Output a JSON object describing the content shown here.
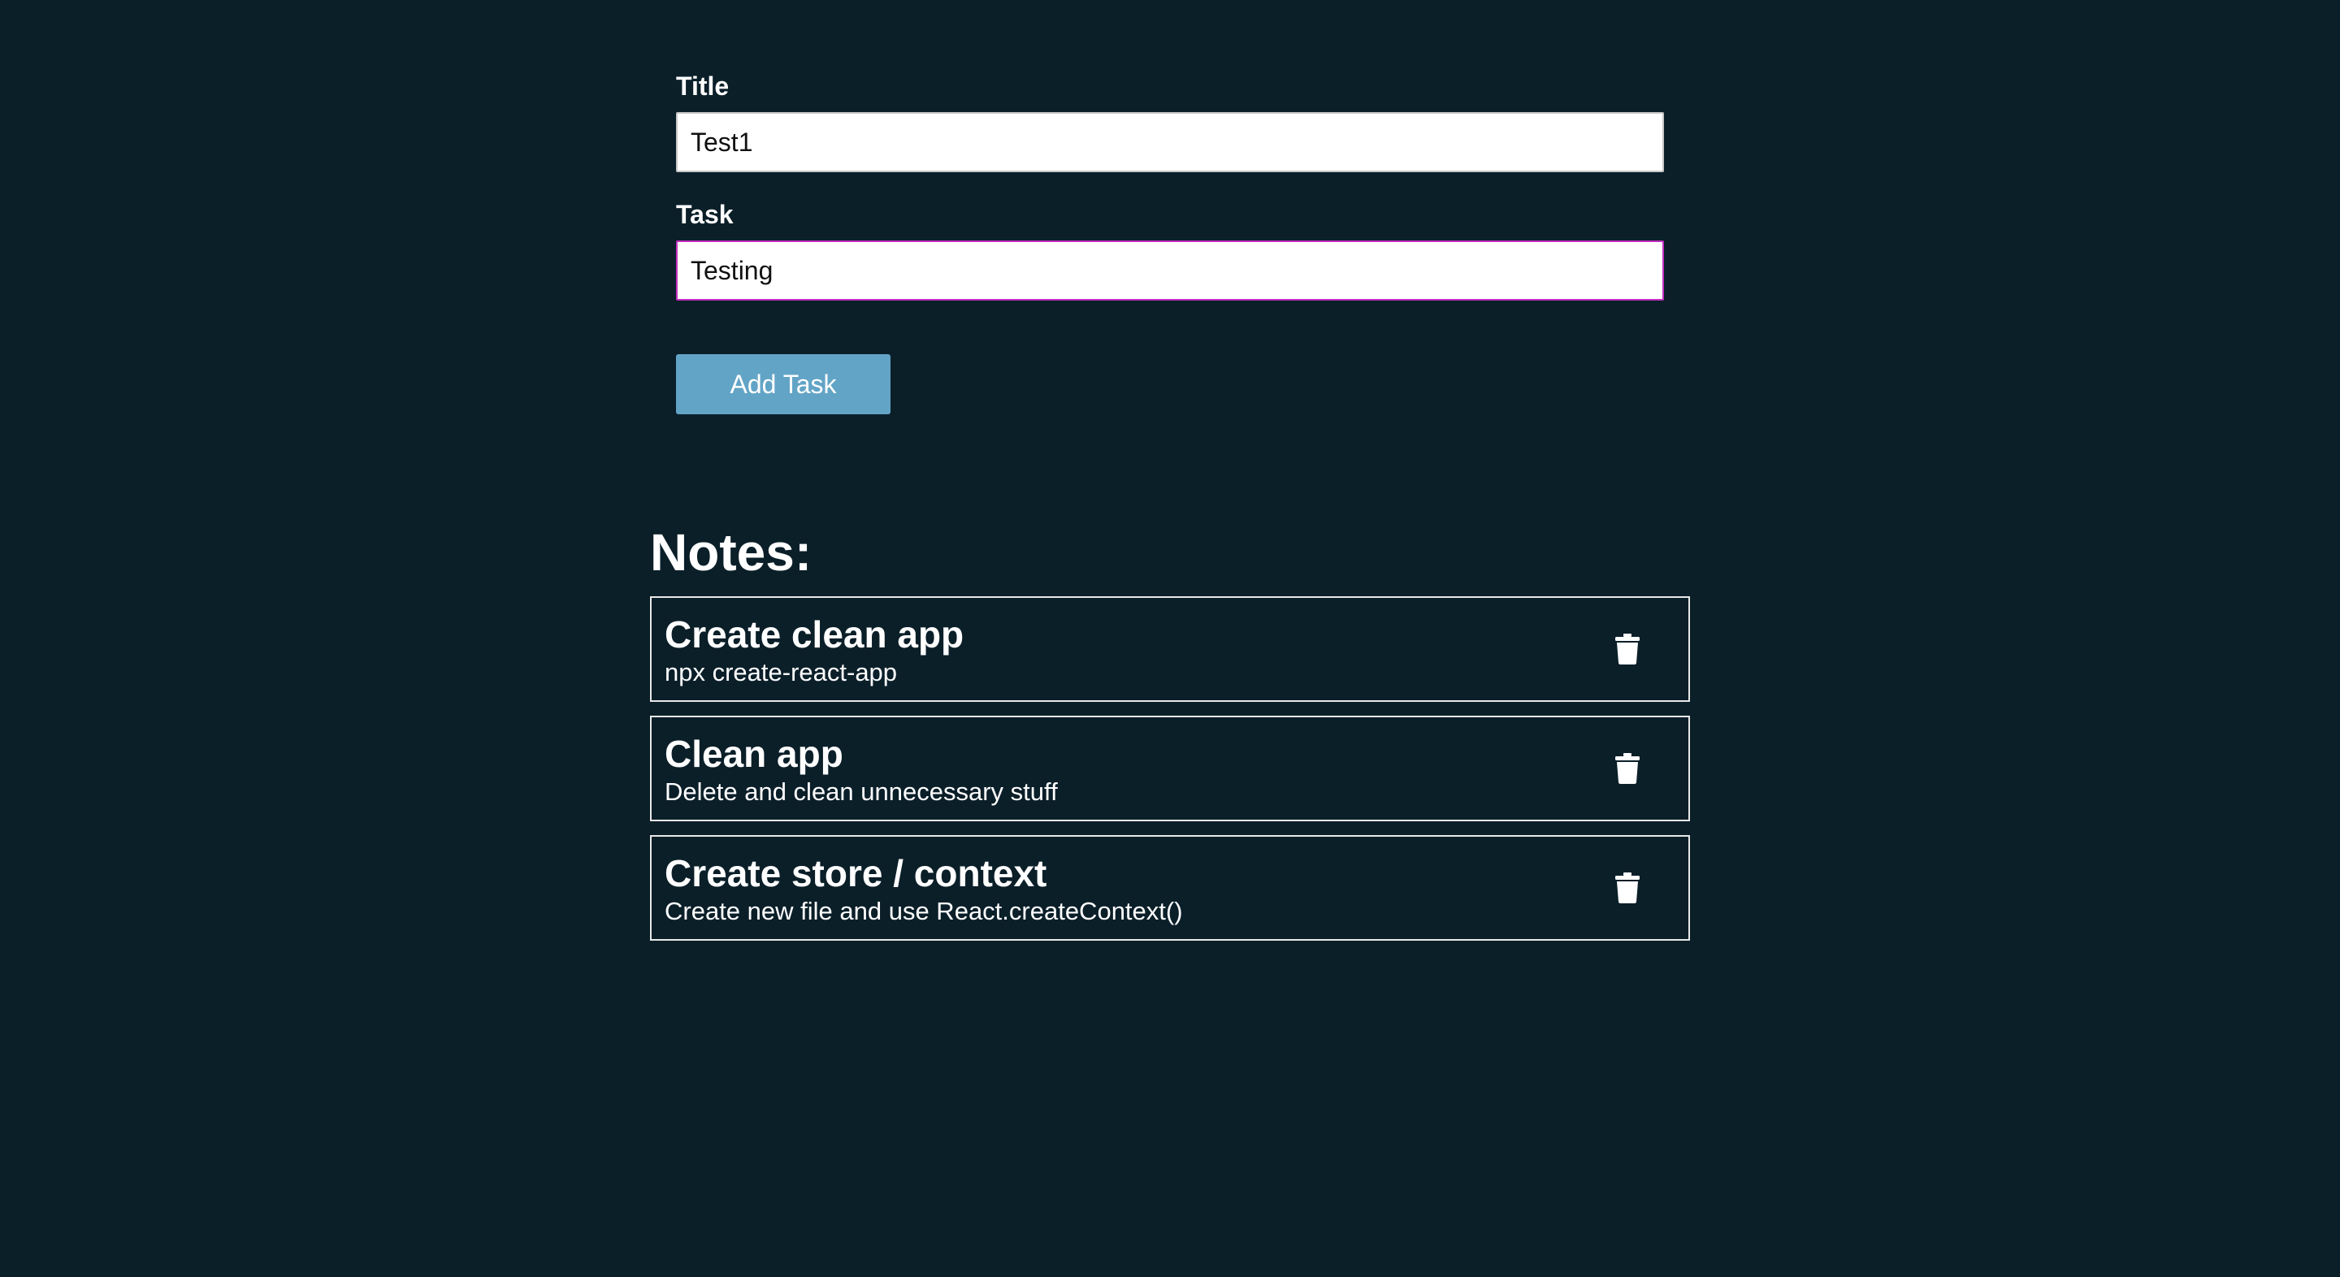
{
  "form": {
    "title_label": "Title",
    "title_value": "Test1",
    "task_label": "Task",
    "task_value": "Testing",
    "submit_label": "Add Task"
  },
  "notes": {
    "heading": "Notes:",
    "items": [
      {
        "title": "Create clean app",
        "body": "npx create-react-app"
      },
      {
        "title": "Clean app",
        "body": "Delete and clean unnecessary stuff"
      },
      {
        "title": "Create store / context",
        "body": "Create new file and use React.createContext()"
      }
    ],
    "delete_icon": "trash-icon"
  },
  "colors": {
    "background": "#0b1f29",
    "button": "#62a4c6",
    "focus_border": "#c42fc2"
  }
}
